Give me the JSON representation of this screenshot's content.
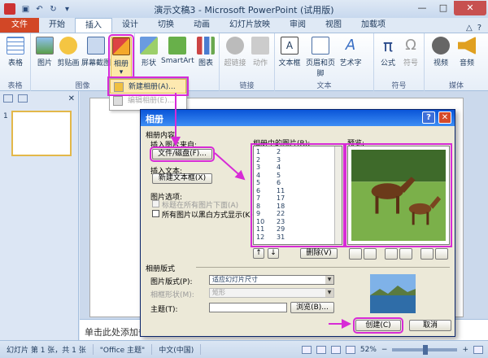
{
  "window": {
    "title": "演示文稿3 - Microsoft PowerPoint (试用版)",
    "controls": {
      "minimize": "—",
      "maximize": "□",
      "close": "✕"
    }
  },
  "tabs": [
    "文件",
    "开始",
    "插入",
    "设计",
    "切换",
    "动画",
    "幻灯片放映",
    "审阅",
    "视图",
    "加载项"
  ],
  "active_tab": "插入",
  "ribbon": {
    "groups": {
      "table": {
        "label": "表格",
        "buttons": [
          "表格"
        ]
      },
      "images": {
        "label": "图像",
        "buttons": [
          "图片",
          "剪贴画",
          "屏幕截图",
          "相册"
        ]
      },
      "illustrations": {
        "label": "",
        "buttons": [
          "形状",
          "SmartArt",
          "图表"
        ]
      },
      "links": {
        "label": "链接",
        "buttons": [
          "超链接",
          "动作"
        ]
      },
      "text": {
        "label": "文本",
        "buttons": [
          "文本框",
          "页眉和页脚",
          "艺术字"
        ]
      },
      "symbols": {
        "label": "符号",
        "buttons": [
          "公式",
          "符号"
        ]
      },
      "media": {
        "label": "媒体",
        "buttons": [
          "视频",
          "音频"
        ]
      }
    }
  },
  "album_menu": {
    "new": "新建相册(A)...",
    "edit": "编辑相册(E)..."
  },
  "notes_placeholder": "单击此处添加备注",
  "slide_number": "1",
  "status": {
    "slide": "幻灯片 第 1 张，共 1 张",
    "theme": "\"Office 主题\"",
    "language": "中文(中国)",
    "zoom": "52%"
  },
  "dialog": {
    "title": "相册",
    "help": "?",
    "close": "✕",
    "content_label": "相册内容",
    "insert_from": "插入图片来自:",
    "file_disk_btn": "文件/磁盘(F)...",
    "insert_text": "插入文本:",
    "new_textbox_btn": "新建文本框(X)",
    "picture_options": "图片选项:",
    "opt_caption": "标题在所有图片下面(A)",
    "opt_bw": "所有图片以黑白方式显示(K)",
    "pictures_label": "相册中的图片(R):",
    "preview_label": "预览:",
    "pictures": [
      [
        "1",
        "2"
      ],
      [
        "2",
        "3"
      ],
      [
        "3",
        "4"
      ],
      [
        "4",
        "5"
      ],
      [
        "5",
        "6"
      ],
      [
        "6",
        "11"
      ],
      [
        "7",
        "17"
      ],
      [
        "8",
        "18"
      ],
      [
        "9",
        "22"
      ],
      [
        "10",
        "23"
      ],
      [
        "11",
        "29"
      ],
      [
        "12",
        "31"
      ]
    ],
    "remove_btn": "删除(V)",
    "layout_label": "相册版式",
    "picture_layout_label": "图片版式(P):",
    "picture_layout_value": "适应幻灯片尺寸",
    "frame_shape_label": "相框形状(M):",
    "frame_shape_value": "矩形",
    "theme_label": "主题(T):",
    "theme_value": "",
    "browse_btn": "浏览(B)...",
    "create_btn": "创建(C)",
    "cancel_btn": "取消"
  },
  "colors": {
    "highlight": "#d72bd6",
    "file_tab": "#d24726",
    "accent": "#1e395b"
  }
}
